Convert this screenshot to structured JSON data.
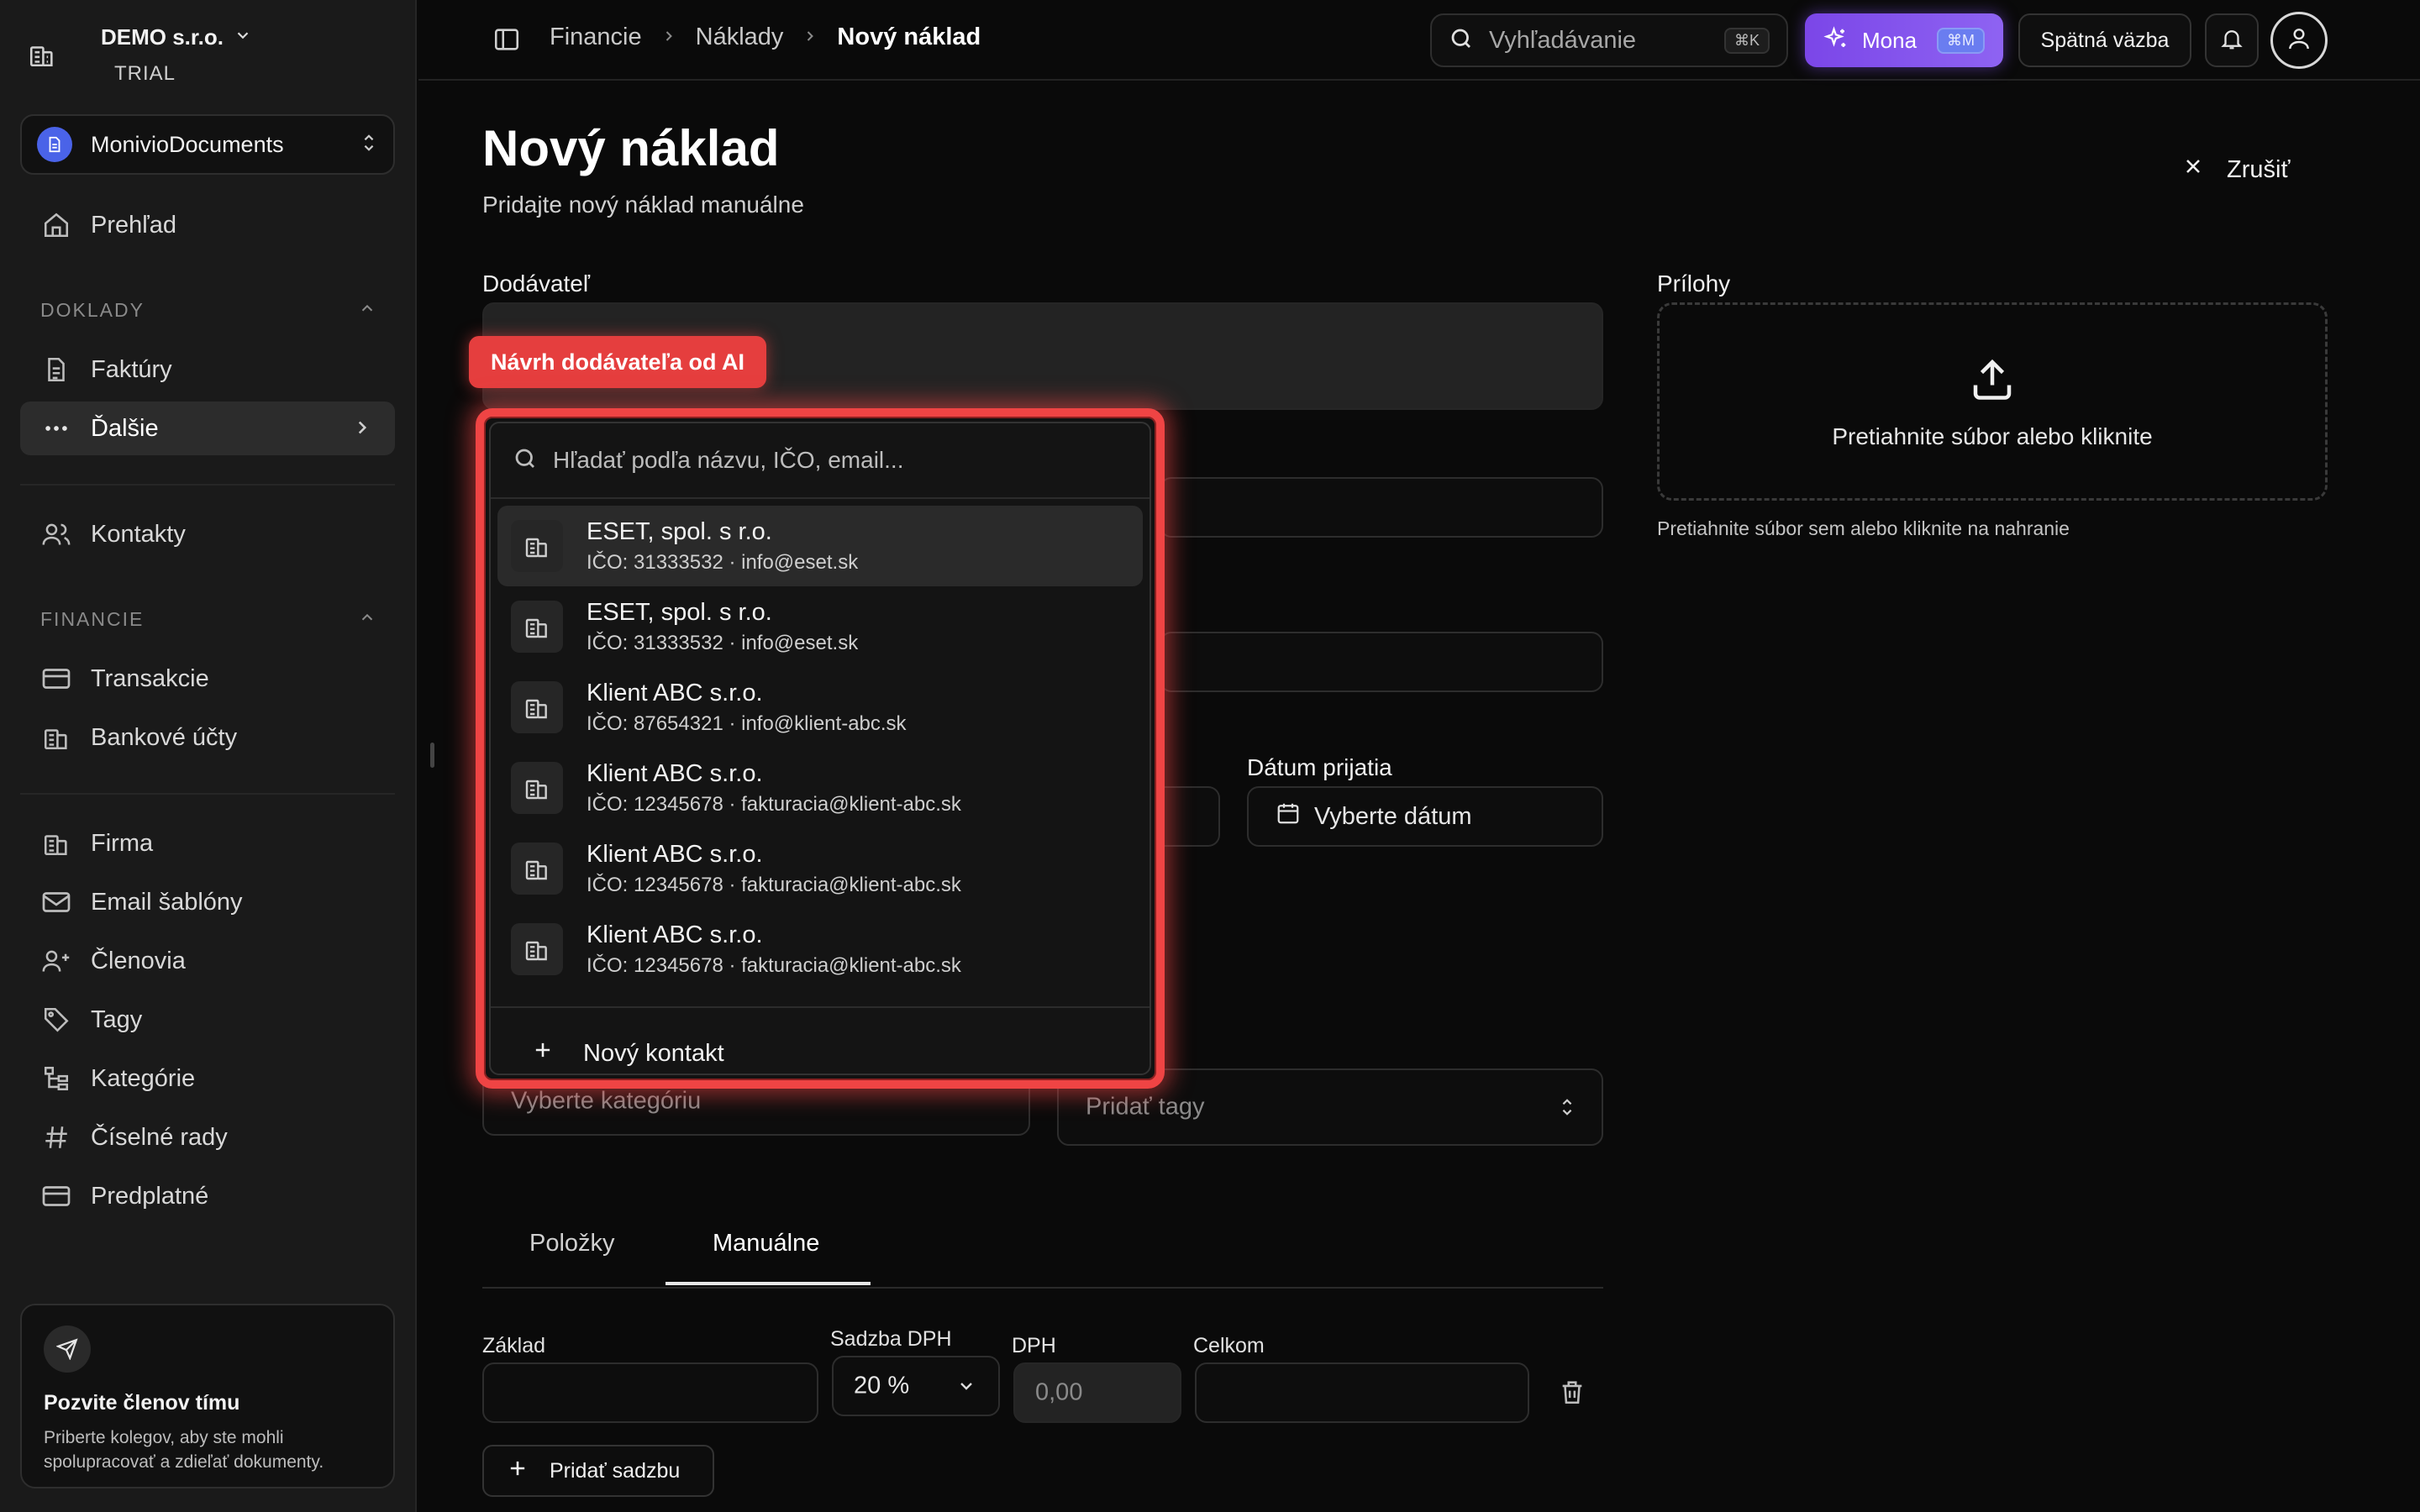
{
  "sidebar": {
    "org_name": "DEMO s.r.o.",
    "org_plan": "TRIAL",
    "workspace": "MonivioDocuments",
    "items": [
      {
        "label": "Prehľad",
        "icon": "home-icon"
      },
      {
        "label": "Faktúry",
        "icon": "document-icon"
      },
      {
        "label": "Ďalšie",
        "icon": "more-icon"
      },
      {
        "label": "Kontakty",
        "icon": "users-icon"
      },
      {
        "label": "Transakcie",
        "icon": "card-icon"
      },
      {
        "label": "Bankové účty",
        "icon": "bank-icon"
      },
      {
        "label": "Firma",
        "icon": "building-icon"
      },
      {
        "label": "Email šablóny",
        "icon": "mail-icon"
      },
      {
        "label": "Členovia",
        "icon": "user-plus-icon"
      },
      {
        "label": "Tagy",
        "icon": "tag-icon"
      },
      {
        "label": "Kategórie",
        "icon": "tree-icon"
      },
      {
        "label": "Číselné rady",
        "icon": "hash-icon"
      },
      {
        "label": "Predplatné",
        "icon": "card-icon"
      }
    ],
    "sections": {
      "doklady": "DOKLADY",
      "financie": "FINANCIE"
    },
    "invite": {
      "title": "Pozvite členov tímu",
      "desc": "Priberte kolegov, aby ste mohli spolupracovať a zdieľať dokumenty."
    }
  },
  "topbar": {
    "breadcrumb": [
      "Financie",
      "Náklady",
      "Nový náklad"
    ],
    "search_placeholder": "Vyhľadávanie",
    "search_kbd": "⌘K",
    "mona_label": "Mona",
    "mona_kbd": "⌘M",
    "feedback_label": "Spätná väzba"
  },
  "page": {
    "title": "Nový náklad",
    "subtitle": "Pridajte nový náklad manuálne",
    "cancel_label": "Zrušiť"
  },
  "form": {
    "supplier_label": "Dodávateľ",
    "received_date_label": "Dátum prijatia",
    "received_date_placeholder": "Vyberte dátum",
    "category_placeholder": "Vyberte kategóriu",
    "tags_placeholder": "Pridať tagy",
    "attachments_label": "Prílohy",
    "dropzone_text": "Pretiahnite súbor alebo kliknite",
    "dropzone_help": "Pretiahnite súbor sem alebo kliknite na nahranie"
  },
  "tabs": [
    {
      "label": "Položky",
      "active": false
    },
    {
      "label": "Manuálne",
      "active": true
    }
  ],
  "vat_row": {
    "base_label": "Základ",
    "rate_label": "Sadzba DPH",
    "rate_value": "20 %",
    "vat_label": "DPH",
    "vat_placeholder": "0,00",
    "total_label": "Celkom",
    "add_rate_label": "Pridať sadzbu"
  },
  "ai_popover": {
    "badge": "Návrh dodávateľa od AI",
    "search_placeholder": "Hľadať podľa názvu, IČO, email...",
    "options": [
      {
        "name": "ESET, spol. s r.o.",
        "meta": "IČO: 31333532 · info@eset.sk"
      },
      {
        "name": "ESET, spol. s r.o.",
        "meta": "IČO: 31333532 · info@eset.sk"
      },
      {
        "name": "Klient ABC s.r.o.",
        "meta": "IČO: 87654321 · info@klient-abc.sk"
      },
      {
        "name": "Klient ABC s.r.o.",
        "meta": "IČO: 12345678 · fakturacia@klient-abc.sk"
      },
      {
        "name": "Klient ABC s.r.o.",
        "meta": "IČO: 12345678 · fakturacia@klient-abc.sk"
      },
      {
        "name": "Klient ABC s.r.o.",
        "meta": "IČO: 12345678 · fakturacia@klient-abc.sk"
      }
    ],
    "new_contact_label": "Nový kontakt"
  },
  "colors": {
    "accent_purple": "#7b46e8",
    "ai_red": "#ef4444",
    "workspace_blue": "#4a63e8"
  }
}
